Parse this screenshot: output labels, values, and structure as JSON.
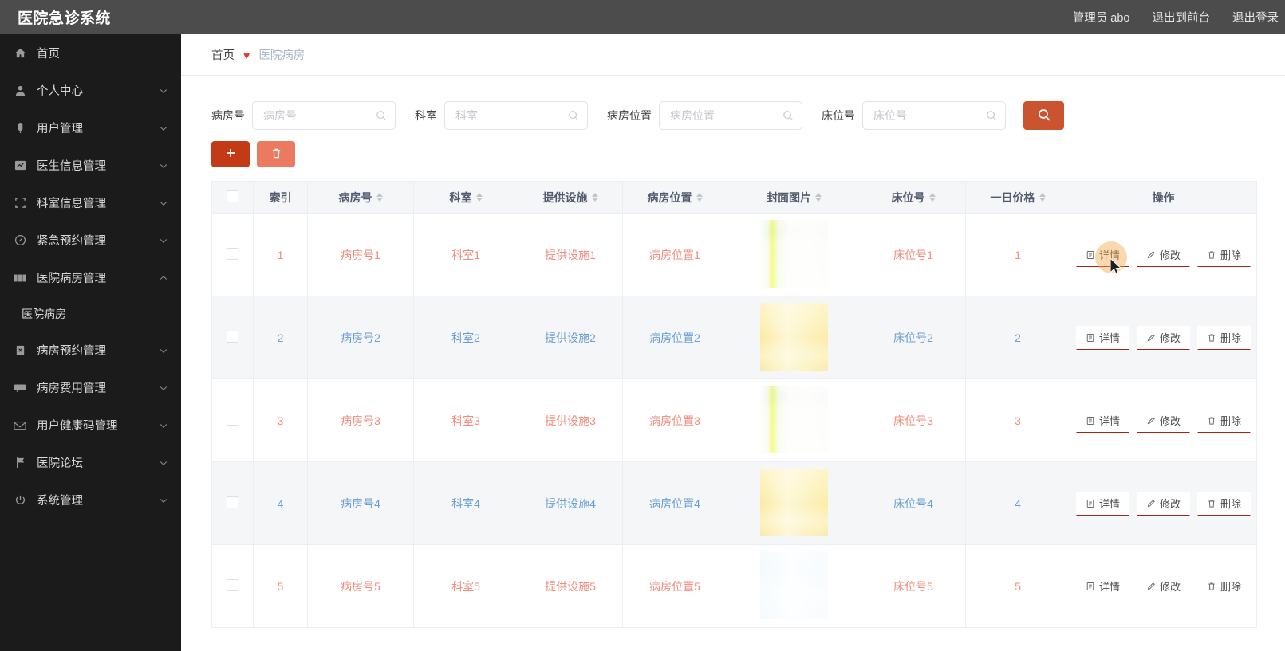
{
  "app": {
    "title": "医院急诊系统",
    "accent_primary": "#c33a16",
    "accent_secondary": "#ec7a60",
    "search_button_color": "#ca5430",
    "topbar_bg": "#4c4c4c",
    "sidebar_bg": "#1b1b1b",
    "row_odd_text": "#f08a7a",
    "row_even_text": "#6a9fd4"
  },
  "topbar": {
    "user_label": "管理员 abo",
    "exit_front_label": "退出到前台",
    "logout_label": "退出登录"
  },
  "sidebar": {
    "items": [
      {
        "label": "首页",
        "icon": "home-icon",
        "expandable": false,
        "expanded": false
      },
      {
        "label": "个人中心",
        "icon": "user-icon",
        "expandable": true,
        "expanded": false
      },
      {
        "label": "用户管理",
        "icon": "id-card-icon",
        "expandable": true,
        "expanded": false
      },
      {
        "label": "医生信息管理",
        "icon": "chart-icon",
        "expandable": true,
        "expanded": false
      },
      {
        "label": "科室信息管理",
        "icon": "scan-frame-icon",
        "expandable": true,
        "expanded": false
      },
      {
        "label": "紧急预约管理",
        "icon": "clock-icon",
        "expandable": true,
        "expanded": false
      },
      {
        "label": "医院病房管理",
        "icon": "ticket-icon",
        "expandable": true,
        "expanded": true
      },
      {
        "label": "病房预约管理",
        "icon": "clipboard-icon",
        "expandable": true,
        "expanded": false
      },
      {
        "label": "病房费用管理",
        "icon": "comment-icon",
        "expandable": true,
        "expanded": false
      },
      {
        "label": "用户健康码管理",
        "icon": "mail-icon",
        "expandable": true,
        "expanded": false
      },
      {
        "label": "医院论坛",
        "icon": "flag-icon",
        "expandable": true,
        "expanded": false
      },
      {
        "label": "系统管理",
        "icon": "power-icon",
        "expandable": true,
        "expanded": false
      }
    ],
    "submenu": {
      "parent_index": 6,
      "label": "医院病房"
    }
  },
  "breadcrumb": {
    "home": "首页",
    "separator": "♥",
    "current": "医院病房"
  },
  "search": {
    "fields": [
      {
        "label": "病房号",
        "placeholder": "病房号",
        "value": ""
      },
      {
        "label": "科室",
        "placeholder": "科室",
        "value": ""
      },
      {
        "label": "病房位置",
        "placeholder": "病房位置",
        "value": ""
      },
      {
        "label": "床位号",
        "placeholder": "床位号",
        "value": ""
      }
    ],
    "submit_icon": "search-icon"
  },
  "toolbar": {
    "add_icon": "plus-icon",
    "delete_icon": "trash-icon"
  },
  "table": {
    "columns": [
      {
        "label": "",
        "sortable": false,
        "key": "checkbox"
      },
      {
        "label": "索引",
        "sortable": false,
        "key": "index"
      },
      {
        "label": "病房号",
        "sortable": true,
        "key": "ward_no"
      },
      {
        "label": "科室",
        "sortable": true,
        "key": "department"
      },
      {
        "label": "提供设施",
        "sortable": true,
        "key": "facilities"
      },
      {
        "label": "病房位置",
        "sortable": true,
        "key": "location"
      },
      {
        "label": "封面图片",
        "sortable": true,
        "key": "cover"
      },
      {
        "label": "床位号",
        "sortable": true,
        "key": "bed_no"
      },
      {
        "label": "一日价格",
        "sortable": true,
        "key": "price"
      },
      {
        "label": "操作",
        "sortable": false,
        "key": "ops"
      }
    ],
    "ops_labels": {
      "detail": "详情",
      "edit": "修改",
      "delete": "删除"
    },
    "rows": [
      {
        "index": "1",
        "ward_no": "病房号1",
        "department": "科室1",
        "facilities": "提供设施1",
        "location": "病房位置1",
        "bed_no": "床位号1",
        "price": "1",
        "cover": "hospital-corridor-green"
      },
      {
        "index": "2",
        "ward_no": "病房号2",
        "department": "科室2",
        "facilities": "提供设施2",
        "location": "病房位置2",
        "bed_no": "床位号2",
        "price": "2",
        "cover": "hospital-lobby-gold"
      },
      {
        "index": "3",
        "ward_no": "病房号3",
        "department": "科室3",
        "facilities": "提供设施3",
        "location": "病房位置3",
        "bed_no": "床位号3",
        "price": "3",
        "cover": "hospital-corridor-green"
      },
      {
        "index": "4",
        "ward_no": "病房号4",
        "department": "科室4",
        "facilities": "提供设施4",
        "location": "病房位置4",
        "bed_no": "床位号4",
        "price": "4",
        "cover": "hospital-lobby-gold"
      },
      {
        "index": "5",
        "ward_no": "病房号5",
        "department": "科室5",
        "facilities": "提供设施5",
        "location": "病房位置5",
        "bed_no": "床位号5",
        "price": "5",
        "cover": "hospital-room-white"
      }
    ]
  }
}
